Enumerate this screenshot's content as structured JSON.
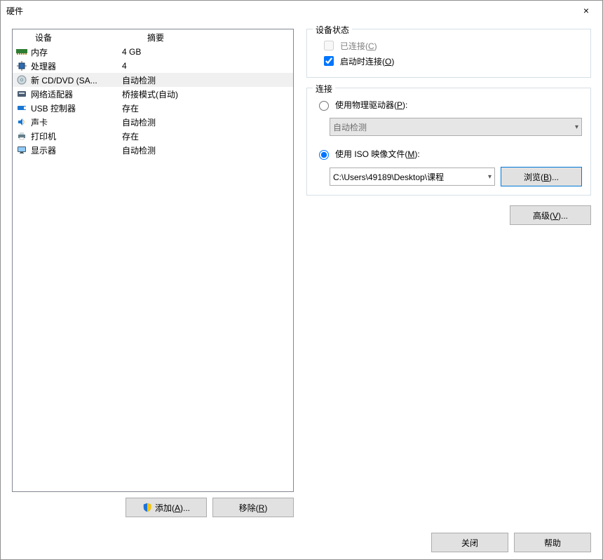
{
  "window": {
    "title": "硬件",
    "close_icon": "×"
  },
  "devlist": {
    "headers": {
      "device": "设备",
      "summary": "摘要"
    },
    "rows": [
      {
        "name": "内存",
        "summary": "4 GB",
        "icon": "memory"
      },
      {
        "name": "处理器",
        "summary": "4",
        "icon": "cpu"
      },
      {
        "name": "新 CD/DVD (SA...",
        "summary": "自动检测",
        "icon": "disc",
        "selected": true
      },
      {
        "name": "网络适配器",
        "summary": "桥接模式(自动)",
        "icon": "nic"
      },
      {
        "name": "USB 控制器",
        "summary": "存在",
        "icon": "usb"
      },
      {
        "name": "声卡",
        "summary": "自动检测",
        "icon": "sound"
      },
      {
        "name": "打印机",
        "summary": "存在",
        "icon": "printer"
      },
      {
        "name": "显示器",
        "summary": "自动检测",
        "icon": "display"
      }
    ]
  },
  "left_buttons": {
    "add": {
      "label": "添加(",
      "key": "A",
      "suffix": ")..."
    },
    "remove": {
      "label": "移除(",
      "key": "R",
      "suffix": ")"
    }
  },
  "group_status": {
    "legend": "设备状态",
    "connected": {
      "label": "已连接(",
      "key": "C",
      "suffix": ")",
      "checked": false,
      "enabled": false
    },
    "connect_at_startup": {
      "label": "启动时连接(",
      "key": "O",
      "suffix": ")",
      "checked": true,
      "enabled": true
    }
  },
  "group_conn": {
    "legend": "连接",
    "use_physical": {
      "label": "使用物理驱动器(",
      "key": "P",
      "suffix": "):",
      "checked": false
    },
    "physical_drive_value": "自动检测",
    "use_iso": {
      "label": "使用 ISO 映像文件(",
      "key": "M",
      "suffix": "):",
      "checked": true
    },
    "iso_path": "C:\\Users\\49189\\Desktop\\课程",
    "browse": {
      "label": "浏览(",
      "key": "B",
      "suffix": ")..."
    }
  },
  "advanced": {
    "label": "高级(",
    "key": "V",
    "suffix": ")..."
  },
  "footer": {
    "close": "关闭",
    "help": "帮助"
  }
}
